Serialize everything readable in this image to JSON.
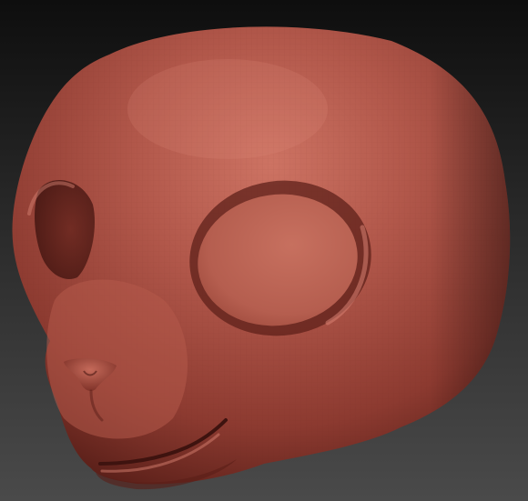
{
  "scene": {
    "subject": "sculpted-cartoon-animal-head",
    "material_colors": {
      "base": "#a8483c",
      "highlight": "#cf7565",
      "shadow": "#5a1e18",
      "deep_shadow": "#3a120e"
    },
    "background_colors": {
      "top": "#0e0e0e",
      "bottom": "#4a4a4a"
    }
  }
}
